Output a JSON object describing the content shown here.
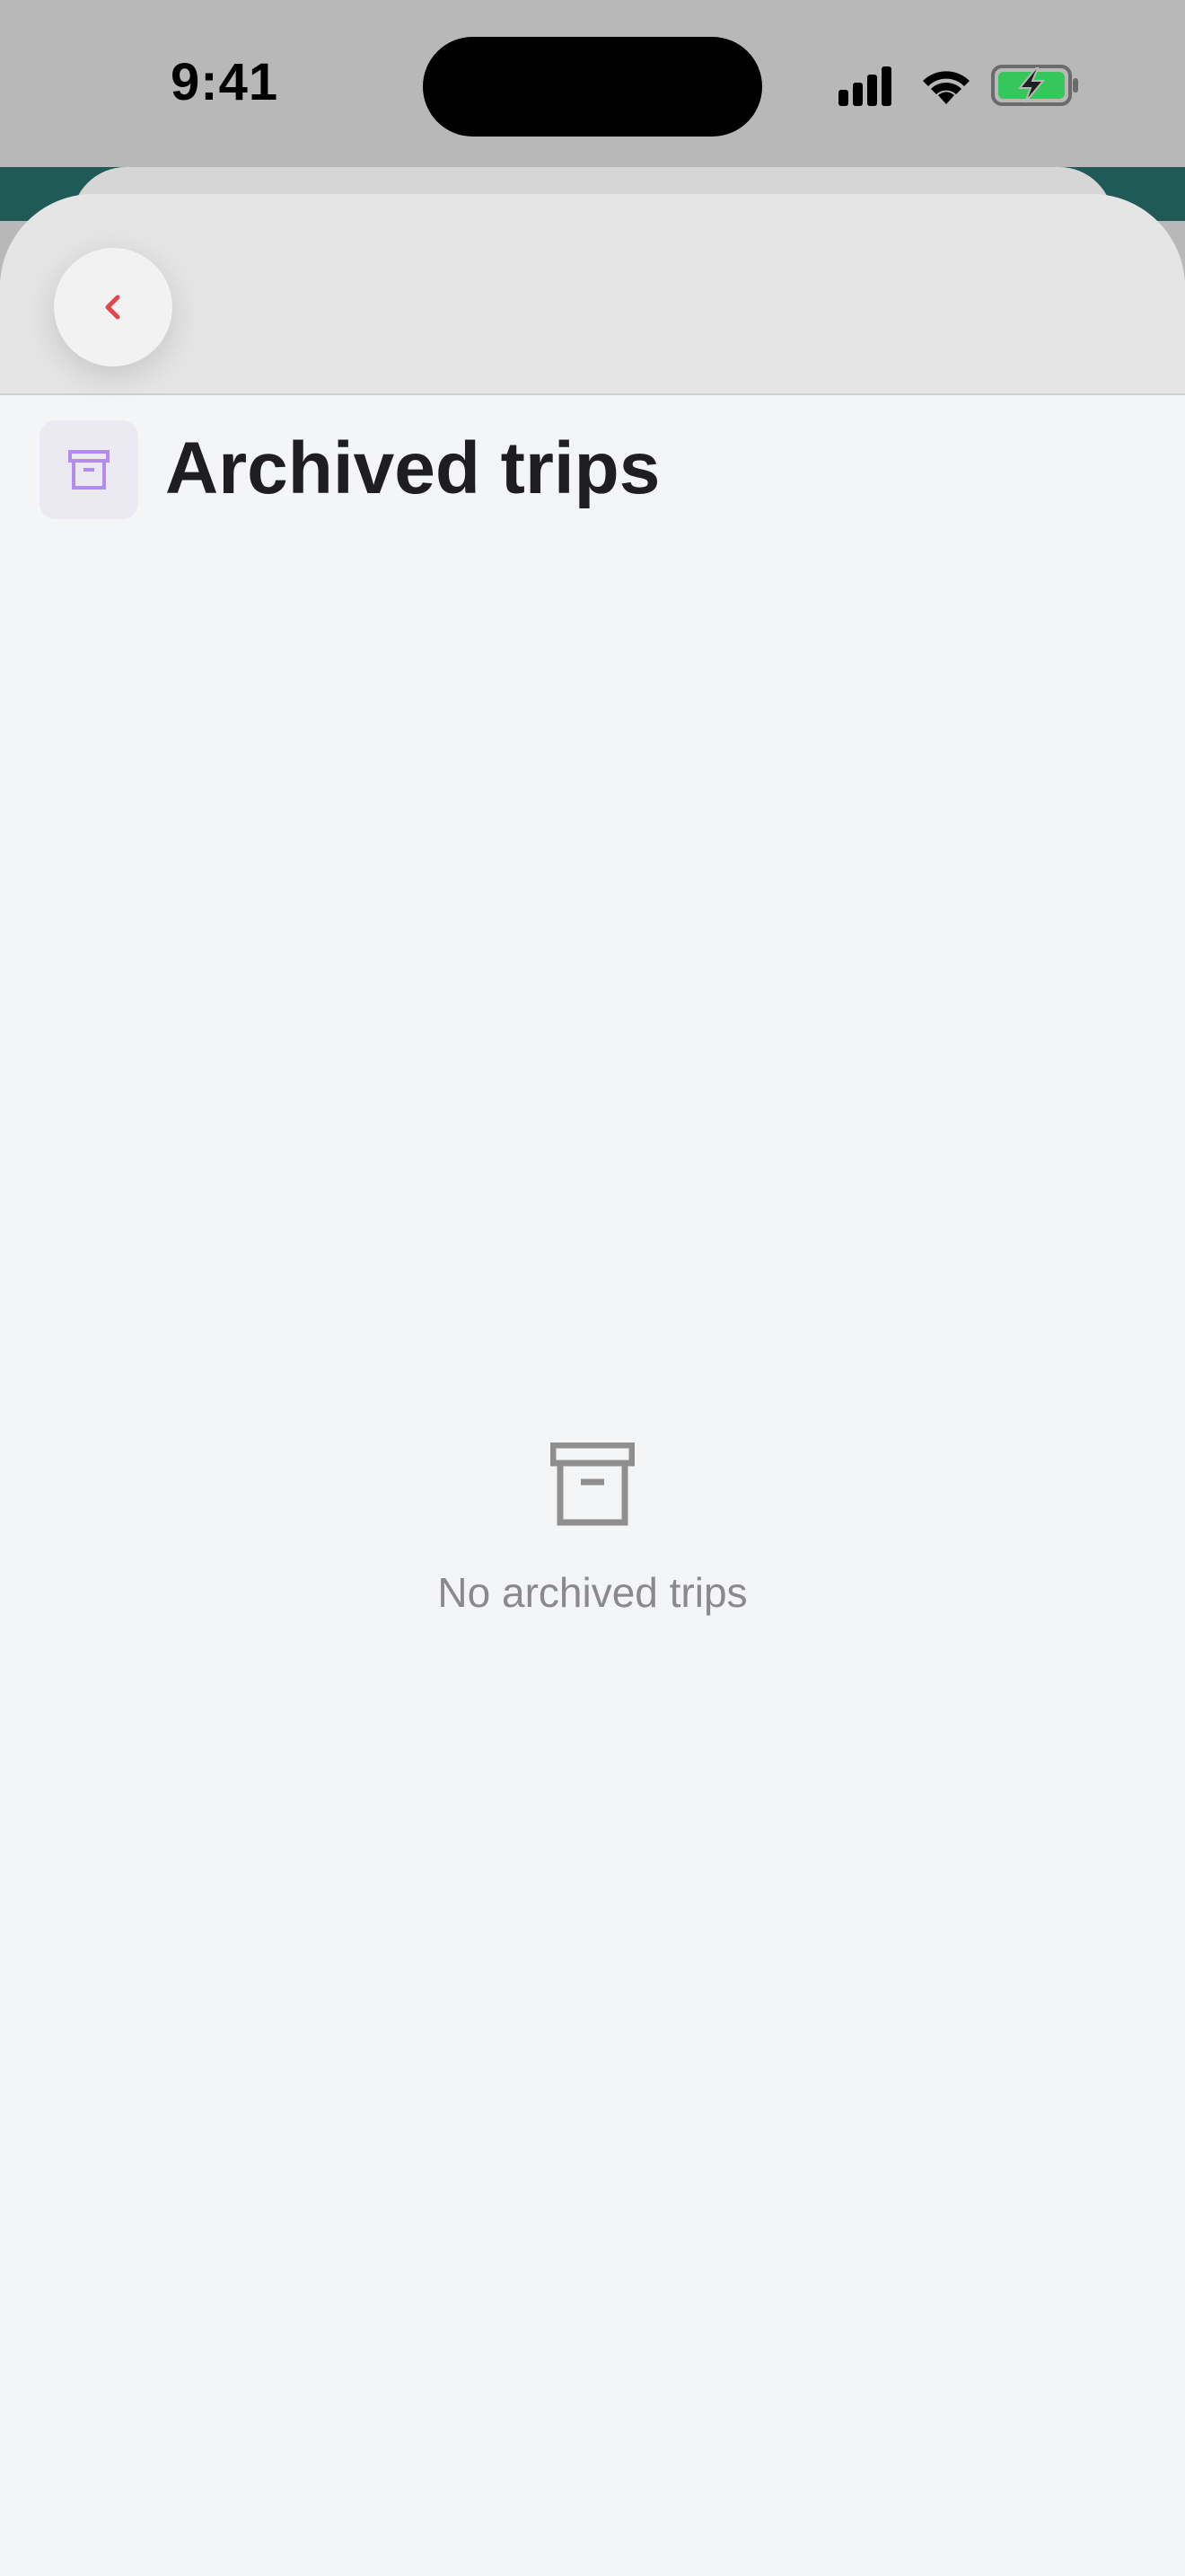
{
  "status_bar": {
    "time": "9:41",
    "icons": [
      "cellular-signal-icon",
      "wifi-icon",
      "battery-charging-icon"
    ]
  },
  "header": {
    "back_icon": "chevron-left-icon",
    "title": "Archived trips",
    "title_icon": "archive-box-icon"
  },
  "empty_state": {
    "icon": "archive-box-icon",
    "message": "No archived trips"
  },
  "colors": {
    "accent_back": "#e0474c",
    "title_icon": "#b48cf0",
    "battery_fill": "#35c759"
  }
}
